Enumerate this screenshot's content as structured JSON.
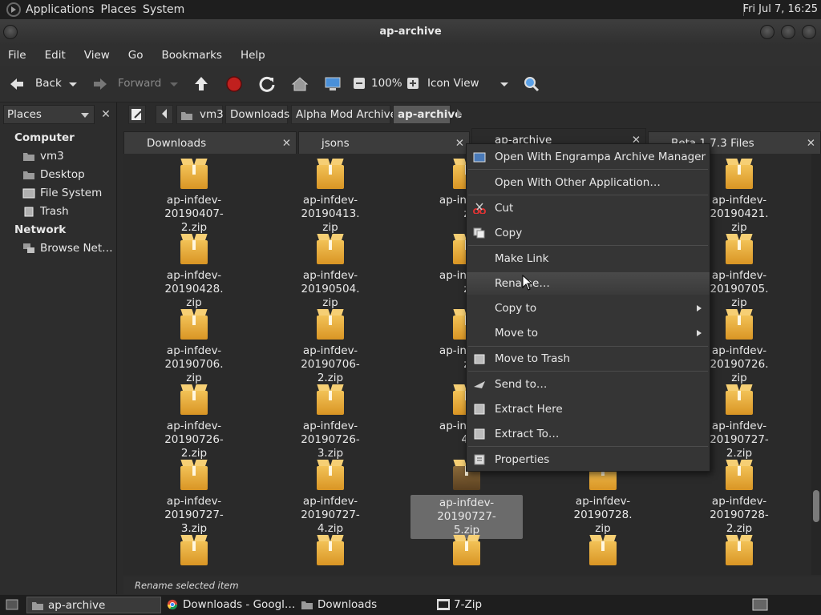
{
  "top_panel": {
    "menus": [
      "Applications",
      "Places",
      "System"
    ],
    "clock": "Fri Jul  7, 16:25"
  },
  "window": {
    "title": "ap-archive"
  },
  "menubar": [
    "File",
    "Edit",
    "View",
    "Go",
    "Bookmarks",
    "Help"
  ],
  "toolbar": {
    "back": "Back",
    "forward": "Forward",
    "zoom": "100%",
    "view_mode": "Icon View"
  },
  "sidebar": {
    "combo": "Places",
    "sections": [
      {
        "title": "Computer",
        "items": [
          "vm3",
          "Desktop",
          "File System",
          "Trash"
        ]
      },
      {
        "title": "Network",
        "items": [
          "Browse Net…"
        ]
      }
    ]
  },
  "pathbar": [
    "vm3",
    "Downloads",
    "Alpha Mod Archive",
    "ap-archive"
  ],
  "tabs": [
    "Downloads",
    "jsons",
    "ap-archive",
    "Beta 1.7.3 Files"
  ],
  "files": [
    [
      "ap-infdev-20190407-\n2.zip",
      "ap-infdev-20190413.\nzip",
      "ap-infdev-\nz",
      "",
      "ap-infdev-20190421.\nzip"
    ],
    [
      "ap-infdev-20190428.\nzip",
      "ap-infdev-20190504.\nzip",
      "ap-infdev-\nz",
      "",
      "ap-infdev-20190705.\nzip"
    ],
    [
      "ap-infdev-20190706.\nzip",
      "ap-infdev-20190706-\n2.zip",
      "ap-infdev-\nz",
      "",
      "ap-infdev-20190726.\nzip"
    ],
    [
      "ap-infdev-20190726-\n2.zip",
      "ap-infdev-20190726-\n3.zip",
      "ap-infdev-\n4.",
      "",
      "ap-infdev-20190727-\n2.zip"
    ],
    [
      "ap-infdev-20190727-\n3.zip",
      "ap-infdev-20190727-\n4.zip",
      "ap-infdev-20190727-\n5.zip",
      "ap-infdev-20190728.\nzip",
      "ap-infdev-20190728-\n2.zip"
    ]
  ],
  "status": "Rename selected item",
  "context_menu": [
    {
      "label": "Open With Engrampa Archive Manager",
      "icon": "archive-manager-icon"
    },
    {
      "label": "Open With Other Application…"
    },
    {
      "label": "Cut",
      "icon": "scissors-icon"
    },
    {
      "label": "Copy",
      "icon": "copy-icon"
    },
    {
      "label": "Make Link"
    },
    {
      "label": "Rename…"
    },
    {
      "label": "Copy to",
      "submenu": true
    },
    {
      "label": "Move to",
      "submenu": true
    },
    {
      "label": "Move to Trash",
      "icon": "trash-icon"
    },
    {
      "label": "Send to…",
      "icon": "send-icon"
    },
    {
      "label": "Extract Here",
      "icon": "extract-icon"
    },
    {
      "label": "Extract To…",
      "icon": "extract-to-icon"
    },
    {
      "label": "Properties",
      "icon": "properties-icon"
    }
  ],
  "taskbar": [
    "ap-archive",
    "Downloads - Googl…",
    "Downloads",
    "7-Zip"
  ]
}
